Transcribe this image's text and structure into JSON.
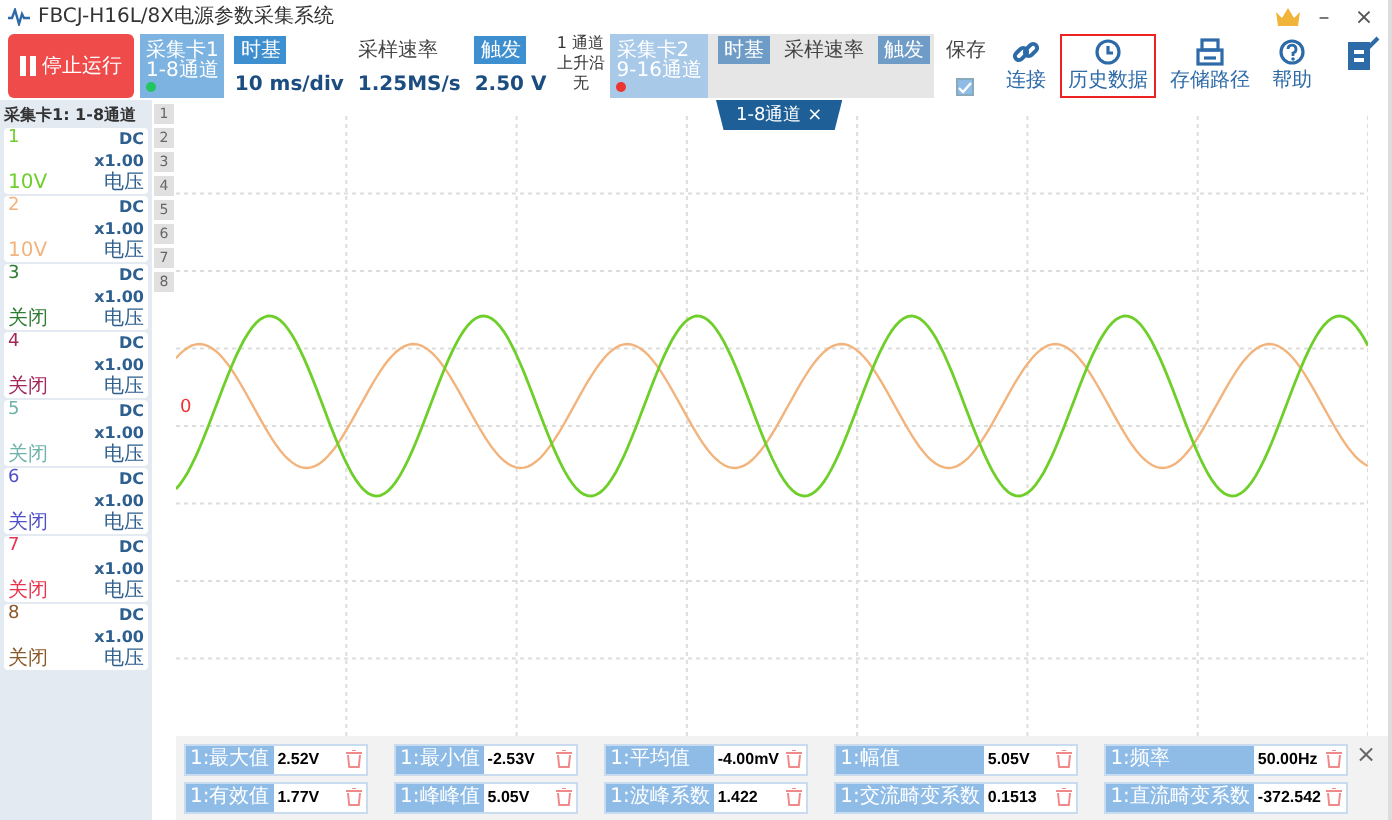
{
  "window": {
    "title": "FBCJ-H16L/8X电源参数采集系统",
    "controls": [
      "–",
      "×"
    ]
  },
  "run_button": {
    "label": "停止运行",
    "running": true
  },
  "groups": [
    {
      "card": {
        "title": "采集卡1",
        "subtitle": "1-8通道",
        "connected": true
      },
      "timebase": {
        "label": "时基",
        "value": "10 ms/div"
      },
      "sample_rate": {
        "label": "采样速率",
        "value": "1.25MS/s"
      },
      "trigger": {
        "label": "触发",
        "value": "2.50 V"
      },
      "trigger_info": [
        "1 通道",
        "上升沿",
        "无"
      ],
      "disabled": false
    },
    {
      "card": {
        "title": "采集卡2",
        "subtitle": "9-16通道",
        "connected": false
      },
      "timebase": {
        "label": "时基"
      },
      "sample_rate": {
        "label": "采样速率"
      },
      "trigger": {
        "label": "触发"
      },
      "disabled": true
    }
  ],
  "save": {
    "label": "保存",
    "checked": true
  },
  "tools": [
    {
      "label": "连接",
      "selected": false
    },
    {
      "label": "历史数据",
      "selected": true
    },
    {
      "label": "存储路径",
      "selected": false
    },
    {
      "label": "帮助",
      "selected": false
    }
  ],
  "channel_panel": {
    "title": "采集卡1: 1-8通道",
    "channels": [
      {
        "number": "1",
        "coupling": "DC",
        "scale": "x1.00",
        "type": "电压",
        "range": "10V",
        "color": "#6fcf2a"
      },
      {
        "number": "2",
        "coupling": "DC",
        "scale": "x1.00",
        "type": "电压",
        "range": "10V",
        "color": "#f2b47c"
      },
      {
        "number": "3",
        "coupling": "DC",
        "scale": "x1.00",
        "type": "电压",
        "range": "关闭",
        "color": "#2e7d32"
      },
      {
        "number": "4",
        "coupling": "DC",
        "scale": "x1.00",
        "type": "电压",
        "range": "关闭",
        "color": "#a3285a"
      },
      {
        "number": "5",
        "coupling": "DC",
        "scale": "x1.00",
        "type": "电压",
        "range": "关闭",
        "color": "#6fb3ad"
      },
      {
        "number": "6",
        "coupling": "DC",
        "scale": "x1.00",
        "type": "电压",
        "range": "关闭",
        "color": "#5050c8"
      },
      {
        "number": "7",
        "coupling": "DC",
        "scale": "x1.00",
        "type": "电压",
        "range": "关闭",
        "color": "#e8344e"
      },
      {
        "number": "8",
        "coupling": "DC",
        "scale": "x1.00",
        "type": "电压",
        "range": "关闭",
        "color": "#8a5a2a"
      }
    ]
  },
  "side_buttons": [
    "1",
    "2",
    "3",
    "4",
    "5",
    "6",
    "7",
    "8"
  ],
  "plot": {
    "tab": {
      "label": "1-8通道",
      "close": "×"
    },
    "zero_label": "0"
  },
  "measurements": [
    {
      "label": "1:最大值",
      "value": "2.52V"
    },
    {
      "label": "1:最小值",
      "value": "-2.53V"
    },
    {
      "label": "1:平均值",
      "value": "-4.00mV"
    },
    {
      "label": "1:幅值",
      "value": "5.05V"
    },
    {
      "label": "1:频率",
      "value": "50.00Hz"
    },
    {
      "label": "1:有效值",
      "value": "1.77V"
    },
    {
      "label": "1:峰峰值",
      "value": "5.05V"
    },
    {
      "label": "1:波峰系数",
      "value": "1.422"
    },
    {
      "label": "1:交流畸变系数",
      "value": "0.1513"
    },
    {
      "label": "1:直流畸变系数",
      "value": "-372.542"
    }
  ],
  "measurements_close": "×"
}
